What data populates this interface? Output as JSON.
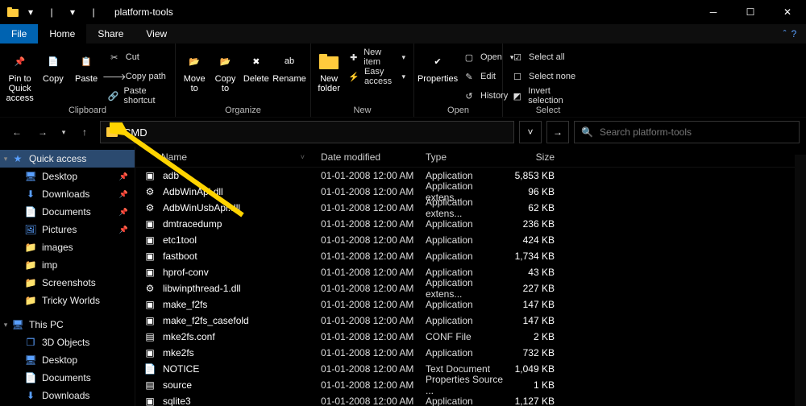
{
  "window": {
    "title": "platform-tools"
  },
  "tabs": {
    "file": "File",
    "home": "Home",
    "share": "Share",
    "view": "View"
  },
  "ribbon": {
    "clipboard": {
      "label": "Clipboard",
      "pin": "Pin to Quick\naccess",
      "copy": "Copy",
      "paste": "Paste",
      "cut": "Cut",
      "copypath": "Copy path",
      "shortcut": "Paste shortcut"
    },
    "organize": {
      "label": "Organize",
      "moveto": "Move\nto",
      "copyto": "Copy\nto",
      "delete": "Delete",
      "rename": "Rename"
    },
    "new": {
      "label": "New",
      "newfolder": "New\nfolder",
      "newitem": "New item",
      "easyaccess": "Easy access"
    },
    "open": {
      "label": "Open",
      "properties": "Properties",
      "open": "Open",
      "edit": "Edit",
      "history": "History"
    },
    "select": {
      "label": "Select",
      "all": "Select all",
      "none": "Select none",
      "invert": "Invert selection"
    }
  },
  "address": {
    "value": "CMD"
  },
  "search": {
    "placeholder": "Search platform-tools"
  },
  "columns": {
    "name": "Name",
    "date": "Date modified",
    "type": "Type",
    "size": "Size"
  },
  "sidebar": {
    "quick": "Quick access",
    "items": [
      {
        "label": "Desktop",
        "pin": true,
        "icon": "desktop"
      },
      {
        "label": "Downloads",
        "pin": true,
        "icon": "download"
      },
      {
        "label": "Documents",
        "pin": true,
        "icon": "doc"
      },
      {
        "label": "Pictures",
        "pin": true,
        "icon": "pic"
      },
      {
        "label": "images",
        "pin": false,
        "icon": "folder"
      },
      {
        "label": "imp",
        "pin": false,
        "icon": "folder"
      },
      {
        "label": "Screenshots",
        "pin": false,
        "icon": "folder"
      },
      {
        "label": "Tricky Worlds",
        "pin": false,
        "icon": "folder"
      }
    ],
    "thispc": "This PC",
    "pcitems": [
      {
        "label": "3D Objects",
        "icon": "cube"
      },
      {
        "label": "Desktop",
        "icon": "desktop"
      },
      {
        "label": "Documents",
        "icon": "doc"
      },
      {
        "label": "Downloads",
        "icon": "download"
      }
    ]
  },
  "files": [
    {
      "name": "adb",
      "date": "01-01-2008 12:00 AM",
      "type": "Application",
      "size": "5,853 KB",
      "icon": "exe"
    },
    {
      "name": "AdbWinApi.dll",
      "date": "01-01-2008 12:00 AM",
      "type": "Application extens...",
      "size": "96 KB",
      "icon": "dll"
    },
    {
      "name": "AdbWinUsbApi.dll",
      "date": "01-01-2008 12:00 AM",
      "type": "Application extens...",
      "size": "62 KB",
      "icon": "dll"
    },
    {
      "name": "dmtracedump",
      "date": "01-01-2008 12:00 AM",
      "type": "Application",
      "size": "236 KB",
      "icon": "exe"
    },
    {
      "name": "etc1tool",
      "date": "01-01-2008 12:00 AM",
      "type": "Application",
      "size": "424 KB",
      "icon": "exe"
    },
    {
      "name": "fastboot",
      "date": "01-01-2008 12:00 AM",
      "type": "Application",
      "size": "1,734 KB",
      "icon": "exe"
    },
    {
      "name": "hprof-conv",
      "date": "01-01-2008 12:00 AM",
      "type": "Application",
      "size": "43 KB",
      "icon": "exe"
    },
    {
      "name": "libwinpthread-1.dll",
      "date": "01-01-2008 12:00 AM",
      "type": "Application extens...",
      "size": "227 KB",
      "icon": "dll"
    },
    {
      "name": "make_f2fs",
      "date": "01-01-2008 12:00 AM",
      "type": "Application",
      "size": "147 KB",
      "icon": "exe"
    },
    {
      "name": "make_f2fs_casefold",
      "date": "01-01-2008 12:00 AM",
      "type": "Application",
      "size": "147 KB",
      "icon": "exe"
    },
    {
      "name": "mke2fs.conf",
      "date": "01-01-2008 12:00 AM",
      "type": "CONF File",
      "size": "2 KB",
      "icon": "conf"
    },
    {
      "name": "mke2fs",
      "date": "01-01-2008 12:00 AM",
      "type": "Application",
      "size": "732 KB",
      "icon": "exe"
    },
    {
      "name": "NOTICE",
      "date": "01-01-2008 12:00 AM",
      "type": "Text Document",
      "size": "1,049 KB",
      "icon": "txt"
    },
    {
      "name": "source",
      "date": "01-01-2008 12:00 AM",
      "type": "Properties Source ...",
      "size": "1 KB",
      "icon": "prop"
    },
    {
      "name": "sqlite3",
      "date": "01-01-2008 12:00 AM",
      "type": "Application",
      "size": "1,127 KB",
      "icon": "exe"
    }
  ]
}
